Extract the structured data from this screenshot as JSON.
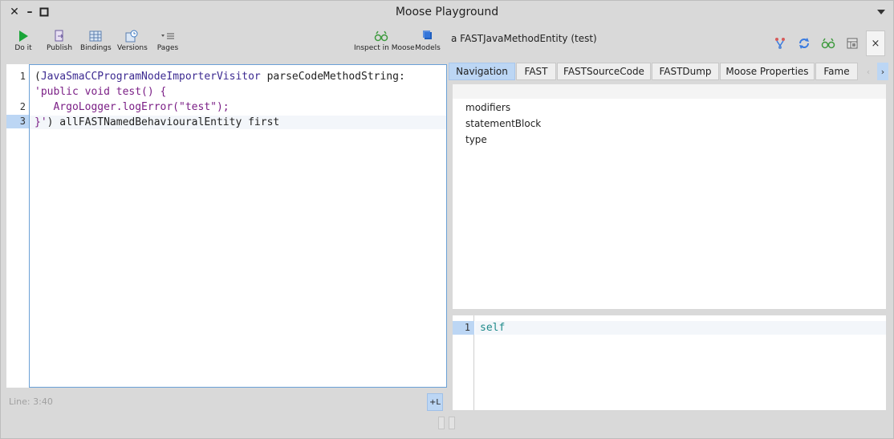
{
  "window": {
    "title": "Moose Playground",
    "close_glyph": "✕",
    "minimize_glyph": "–",
    "maximize_glyph": "□"
  },
  "toolbar": {
    "do_it": "Do it",
    "publish": "Publish",
    "bindings": "Bindings",
    "versions": "Versions",
    "pages": "Pages",
    "inspect_in_moose": "Inspect in Moose",
    "models": "Models"
  },
  "editor": {
    "line_numbers": [
      "1",
      "2",
      "3"
    ],
    "line1_paren": "(",
    "line1_class": "JavaSmaCCProgramNodeImporterVisitor",
    "line1_rest": " parseCodeMethodString:",
    "line1b": "'public void test() {",
    "line2": "   ArgoLogger.logError(\"test\");",
    "line3_str": "}'",
    "line3_rest": ") allFASTNamedBehaviouralEntity first",
    "status": "Line: 3:40",
    "line_toggle": "+L"
  },
  "inspector": {
    "title": "a FASTJavaMethodEntity (test)",
    "close_label": "×",
    "tabs": [
      "Navigation",
      "FAST",
      "FASTSourceCode",
      "FASTDump",
      "Moose Properties",
      "Fame"
    ],
    "active_tab": "Navigation",
    "nav_items": [
      "modifiers",
      "statementBlock",
      "type"
    ],
    "eval_line_number": "1",
    "eval_code": "self"
  },
  "colors": {
    "selection": "#bcd6f4",
    "string": "#7b1f86",
    "class": "#3c2a91",
    "self_keyword": "#1f8a8a",
    "do_it_green": "#1aa538"
  }
}
